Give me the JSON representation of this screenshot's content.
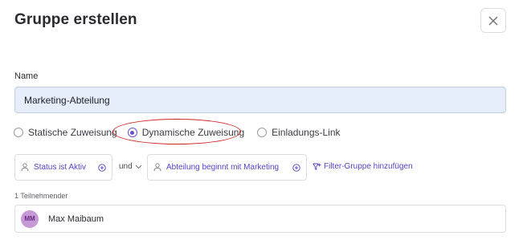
{
  "dialog": {
    "title": "Gruppe erstellen",
    "close_icon": "close-x-icon"
  },
  "name_field": {
    "label": "Name",
    "value": "Marketing-Abteilung"
  },
  "assignment": {
    "options": [
      {
        "label": "Statische Zuweisung",
        "checked": false
      },
      {
        "label": "Dynamische Zuweisung",
        "checked": true
      },
      {
        "label": "Einladungs-Link",
        "checked": false
      }
    ],
    "highlight_color": "#cf2424"
  },
  "filters": {
    "items": [
      {
        "label": "Status ist Aktiv",
        "icon": "user-icon",
        "action_icon": "plus-circle-icon"
      },
      {
        "label": "Abteilung beginnt mit Marketing",
        "icon": "user-icon",
        "action_icon": "plus-circle-icon"
      }
    ],
    "connector": "und",
    "add_group_label": "Filter-Gruppe hinzufügen",
    "accent_color": "#5a3fc8"
  },
  "members": {
    "count_label": "1 Teilnehmender",
    "list": [
      {
        "initials": "MM",
        "name": "Max Maibaum",
        "avatar_color": "#c69ad6"
      }
    ]
  }
}
